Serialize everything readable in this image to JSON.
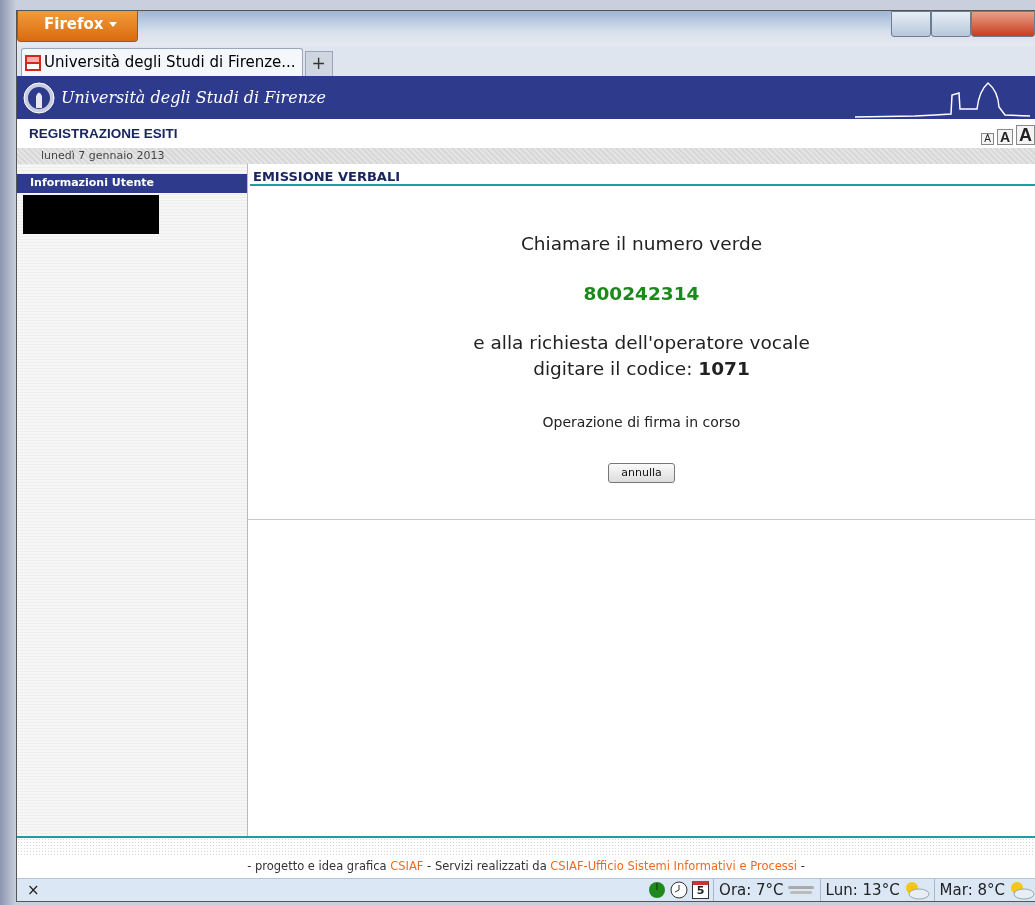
{
  "browser": {
    "menu_button": "Firefox",
    "tabs": [
      {
        "title": "Università degli Studi di Firenze...",
        "selected": true
      }
    ],
    "new_tab": "+"
  },
  "site": {
    "university": "Università degli Studi di Firenze",
    "section": "REGISTRAZIONE ESITI",
    "font_sizes": [
      "A",
      "A",
      "A"
    ],
    "date": "lunedì 7 gennaio 2013"
  },
  "sidebar": {
    "heading": "Informazioni Utente"
  },
  "main": {
    "heading": "EMISSIONE VERBALI",
    "call_text": "Chiamare il numero verde",
    "phone": "800242314",
    "instruction_lines": [
      "e alla richiesta dell'operatore vocale",
      "digitare il codice: **1071**"
    ],
    "status": "Operazione di firma in corso",
    "cancel_button": "annulla"
  },
  "footer": {
    "parts": [
      {
        "kind": "text",
        "text": "- progetto e idea grafica "
      },
      {
        "kind": "link",
        "text": "CSIAF"
      },
      {
        "kind": "text",
        "text": " - Servizi realizzati da "
      },
      {
        "kind": "link",
        "text": "CSIAF-Ufficio Sistemi Informativi e Processi"
      },
      {
        "kind": "text",
        "text": " -"
      }
    ]
  },
  "status_bar": {
    "close": "×",
    "calendar_day": "5",
    "weather": [
      {
        "label": "Ora: 7°C",
        "kind": "fog"
      },
      {
        "label": "Lun: 13°C",
        "kind": "sun-cloud"
      },
      {
        "label": "Mar: 8°C",
        "kind": "sun-cloud"
      }
    ]
  }
}
